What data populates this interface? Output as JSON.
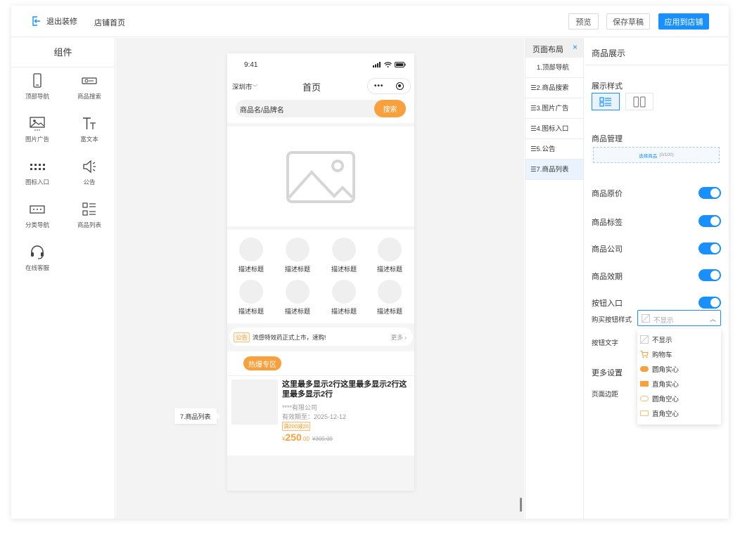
{
  "topbar": {
    "exit_label": "退出装修",
    "shop_home": "店铺首页",
    "preview": "预览",
    "save_draft": "保存草稿",
    "apply": "应用到店铺"
  },
  "components": {
    "title": "组件",
    "items": [
      {
        "label": "顶部导航",
        "icon": "phone-icon"
      },
      {
        "label": "商品搜索",
        "icon": "search-bar-icon"
      },
      {
        "label": "图片广告",
        "icon": "image-icon"
      },
      {
        "label": "富文本",
        "icon": "text-icon"
      },
      {
        "label": "图标入口",
        "icon": "grid-dots-icon"
      },
      {
        "label": "公告",
        "icon": "megaphone-icon"
      },
      {
        "label": "分类导航",
        "icon": "tabs-icon"
      },
      {
        "label": "商品列表",
        "icon": "list-icon"
      },
      {
        "label": "在线客服",
        "icon": "headset-icon"
      }
    ]
  },
  "phone": {
    "time": "9:41",
    "city": "深圳市",
    "page_title": "首页",
    "search_placeholder": "商品名/品牌名",
    "search_button": "搜索",
    "icon_entries": [
      "描述标题",
      "描述标题",
      "描述标题",
      "描述标题",
      "描述标题",
      "描述标题",
      "描述标题",
      "描述标题"
    ],
    "notice": {
      "tag": "公告",
      "text": "流感特效药正式上市，速购!",
      "more": "更多"
    },
    "goods": {
      "section_tag": "热爆专区",
      "name": "这里最多显示2行这里最多显示2行这里最多显示2行",
      "company": "****有限公司",
      "expiry": "有效期至：2025-12-12",
      "coupon": "满200减20",
      "currency": "¥",
      "price_int": "250",
      "price_dec": ".00",
      "original_price": "¥300.00"
    }
  },
  "canvas_tooltip": "7.商品列表",
  "layout": {
    "title": "页面布局",
    "close": "×",
    "items": [
      "1.顶部导航",
      "☰2.商品搜索",
      "☰3.图片广告",
      "☰4.图标入口",
      "☰5.公告",
      "☰7.商品列表"
    ]
  },
  "settings": {
    "title": "商品展示",
    "display_style": "展示样式",
    "goods_manage": "商品管理",
    "select_goods": "选择商品",
    "select_count": "(0/100)",
    "original_price": "商品原价",
    "tags": "商品标签",
    "company": "商品公司",
    "expiry": "商品效期",
    "button_entry": "按钮入口",
    "buy_button_style": "购买按钮样式",
    "buy_button_value": "不显示",
    "button_text": "按钮文字",
    "more_settings": "更多设置",
    "page_margin": "页面边距",
    "dropdown": [
      "不显示",
      "购物车",
      "圆角实心",
      "直角实心",
      "圆角空心",
      "直角空心"
    ]
  },
  "colors": {
    "accent": "#1890ff",
    "orange": "#f7a03c"
  }
}
